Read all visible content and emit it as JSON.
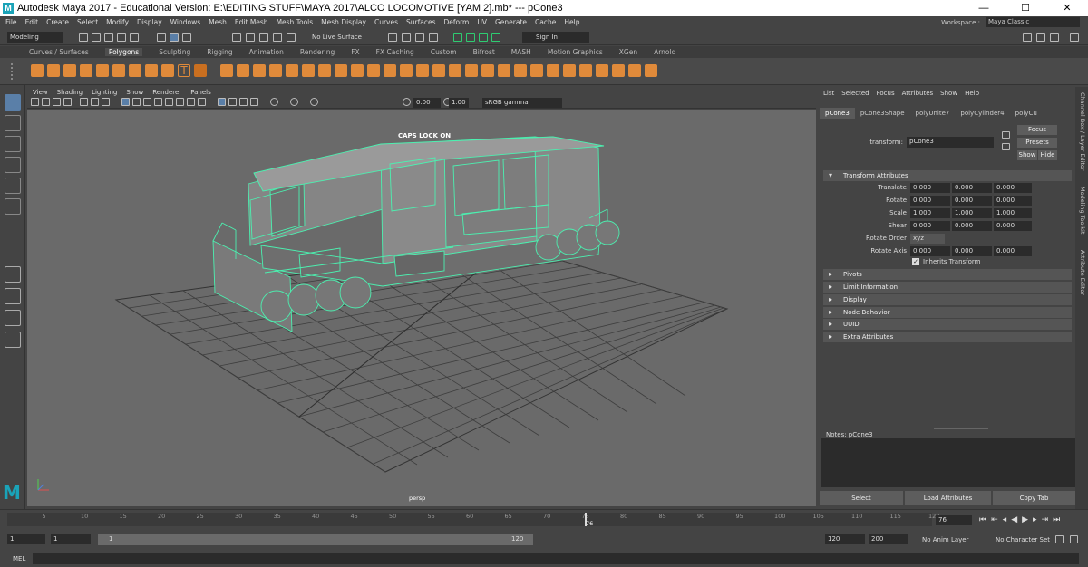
{
  "title": "Autodesk Maya 2017 - Educational Version: E:\\EDITING STUFF\\MAYA 2017\\ALCO LOCOMOTIVE [YAM 2].mb*   ---   pCone3",
  "window_controls": {
    "minimize": "—",
    "maximize": "☐",
    "close": "✕"
  },
  "menu": [
    "File",
    "Edit",
    "Create",
    "Select",
    "Modify",
    "Display",
    "Windows",
    "Mesh",
    "Edit Mesh",
    "Mesh Tools",
    "Mesh Display",
    "Curves",
    "Surfaces",
    "Deform",
    "UV",
    "Generate",
    "Cache",
    "Help"
  ],
  "workspace": {
    "label": "Workspace :",
    "value": "Maya Classic"
  },
  "status_line": {
    "mode": "Modeling",
    "live_surface": "No Live Surface",
    "sign_in": "Sign In"
  },
  "shelf_tabs": [
    "Curves / Surfaces",
    "Polygons",
    "Sculpting",
    "Rigging",
    "Animation",
    "Rendering",
    "FX",
    "FX Caching",
    "Custom",
    "Bifrost",
    "MASH",
    "Motion Graphics",
    "XGen",
    "Arnold"
  ],
  "active_shelf": "Polygons",
  "viewport": {
    "menu": [
      "View",
      "Shading",
      "Lighting",
      "Show",
      "Renderer",
      "Panels"
    ],
    "exposure": "0.00",
    "gamma": "1.00",
    "color_space": "sRGB gamma",
    "caps_lock": "CAPS LOCK ON",
    "camera": "persp"
  },
  "attribute_editor": {
    "menu": [
      "List",
      "Selected",
      "Focus",
      "Attributes",
      "Show",
      "Help"
    ],
    "tabs": [
      "pCone3",
      "pCone3Shape",
      "polyUnite7",
      "polyCylinder4",
      "polyCu"
    ],
    "transform_label": "transform:",
    "transform_value": "pCone3",
    "focus": "Focus",
    "presets": "Presets",
    "show": "Show",
    "hide": "Hide",
    "section": "Transform Attributes",
    "rows": [
      {
        "label": "Translate",
        "values": [
          "0.000",
          "0.000",
          "0.000"
        ]
      },
      {
        "label": "Rotate",
        "values": [
          "0.000",
          "0.000",
          "0.000"
        ]
      },
      {
        "label": "Scale",
        "values": [
          "1.000",
          "1.000",
          "1.000"
        ]
      },
      {
        "label": "Shear",
        "values": [
          "0.000",
          "0.000",
          "0.000"
        ]
      }
    ],
    "rotate_order_label": "Rotate Order",
    "rotate_order": "xyz",
    "rotate_axis": {
      "label": "Rotate Axis",
      "values": [
        "0.000",
        "0.000",
        "0.000"
      ]
    },
    "inherits": "Inherits Transform",
    "collapsed": [
      "Pivots",
      "Limit Information",
      "Display",
      "Node Behavior",
      "UUID",
      "Extra Attributes"
    ],
    "notes": "Notes: pCone3",
    "buttons": [
      "Select",
      "Load Attributes",
      "Copy Tab"
    ]
  },
  "side_tabs": [
    "Channel Box / Layer Editor",
    "Modeling Toolkit",
    "Attribute Editor"
  ],
  "timeline": {
    "ticks": [
      "5",
      "10",
      "15",
      "20",
      "25",
      "30",
      "35",
      "40",
      "45",
      "50",
      "55",
      "60",
      "65",
      "70",
      "75",
      "80",
      "85",
      "90",
      "95",
      "100",
      "105",
      "110",
      "115",
      "120"
    ],
    "current": "76",
    "current_field": "76"
  },
  "range": {
    "start": "1",
    "inner_start": "1",
    "slider_start": "1",
    "slider_end": "120",
    "end": "120",
    "max": "200",
    "anim_layer": "No Anim Layer",
    "char_set": "No Character Set"
  },
  "command_line": {
    "label": "MEL"
  }
}
